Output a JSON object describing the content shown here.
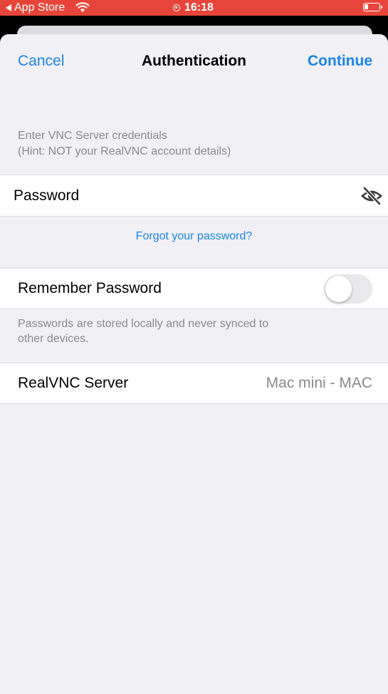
{
  "status_bar": {
    "back_label": "App Store",
    "time": "16:18",
    "accent": "#e7453a"
  },
  "nav": {
    "cancel_label": "Cancel",
    "title": "Authentication",
    "continue_label": "Continue",
    "accent": "#1a84e6"
  },
  "hint": {
    "line1": "Enter VNC Server credentials",
    "line2": "(Hint: NOT your RealVNC account details)"
  },
  "password": {
    "placeholder": "Password",
    "value": "",
    "visibility_icon": "eye-slash-icon"
  },
  "forgot_label": "Forgot your password?",
  "remember": {
    "label": "Remember Password",
    "enabled": false
  },
  "footnote": {
    "line1": "Passwords are stored locally and never synced to",
    "line2": "other devices."
  },
  "server": {
    "label": "RealVNC Server",
    "value": "Mac mini - MAC"
  }
}
